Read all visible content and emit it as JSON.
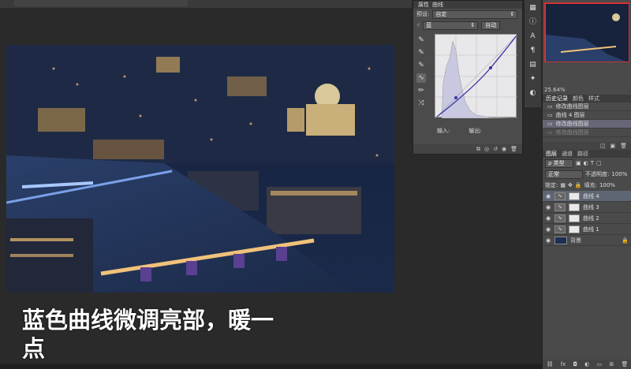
{
  "caption": {
    "line1": "蓝色曲线微调亮部，暖一",
    "line2": "点"
  },
  "properties": {
    "tabs": [
      "属性"
    ],
    "title": "曲线",
    "preset_label": "预设:",
    "preset_value": "自定",
    "channel_value": "蓝",
    "auto_button": "自动",
    "input_label": "输入:",
    "output_label": "输出:",
    "tools": [
      "pointer-adjust-icon",
      "eyedropper-black-icon",
      "eyedropper-gray-icon",
      "eyedropper-white-icon",
      "curve-point-icon",
      "pencil-icon",
      "smooth-icon"
    ]
  },
  "navigator": {
    "zoom": "25.64%"
  },
  "history": {
    "tabs": [
      "历史记录",
      "颜色",
      "样式"
    ],
    "items": [
      {
        "label": "修改曲线图层",
        "state": "normal"
      },
      {
        "label": "曲线 4 图层",
        "state": "normal"
      },
      {
        "label": "修改曲线图层",
        "state": "selected"
      },
      {
        "label": "修改曲线图层",
        "state": "dim"
      }
    ]
  },
  "layers": {
    "tabs": [
      "图层",
      "通道",
      "路径"
    ],
    "filter_label": "ρ 类型",
    "blend_mode": "正常",
    "opacity_label": "不透明度:",
    "opacity_value": "100%",
    "lock_label": "锁定:",
    "fill_label": "填充:",
    "fill_value": "100%",
    "items": [
      {
        "name": "曲线 4",
        "type": "adjustment",
        "active": true
      },
      {
        "name": "曲线 3",
        "type": "adjustment",
        "active": false
      },
      {
        "name": "曲线 2",
        "type": "adjustment",
        "active": false
      },
      {
        "name": "曲线 1",
        "type": "adjustment",
        "active": false
      },
      {
        "name": "背景",
        "type": "background",
        "active": false
      }
    ],
    "footer_icons": [
      "link-icon",
      "fx-icon",
      "mask-icon",
      "adjustment-icon",
      "folder-icon",
      "new-layer-icon",
      "trash-icon"
    ]
  },
  "colors": {
    "accent_selected": "#5f6673",
    "canvas_bg": "#2a2a2a",
    "panel_bg": "#4a4a4a"
  }
}
